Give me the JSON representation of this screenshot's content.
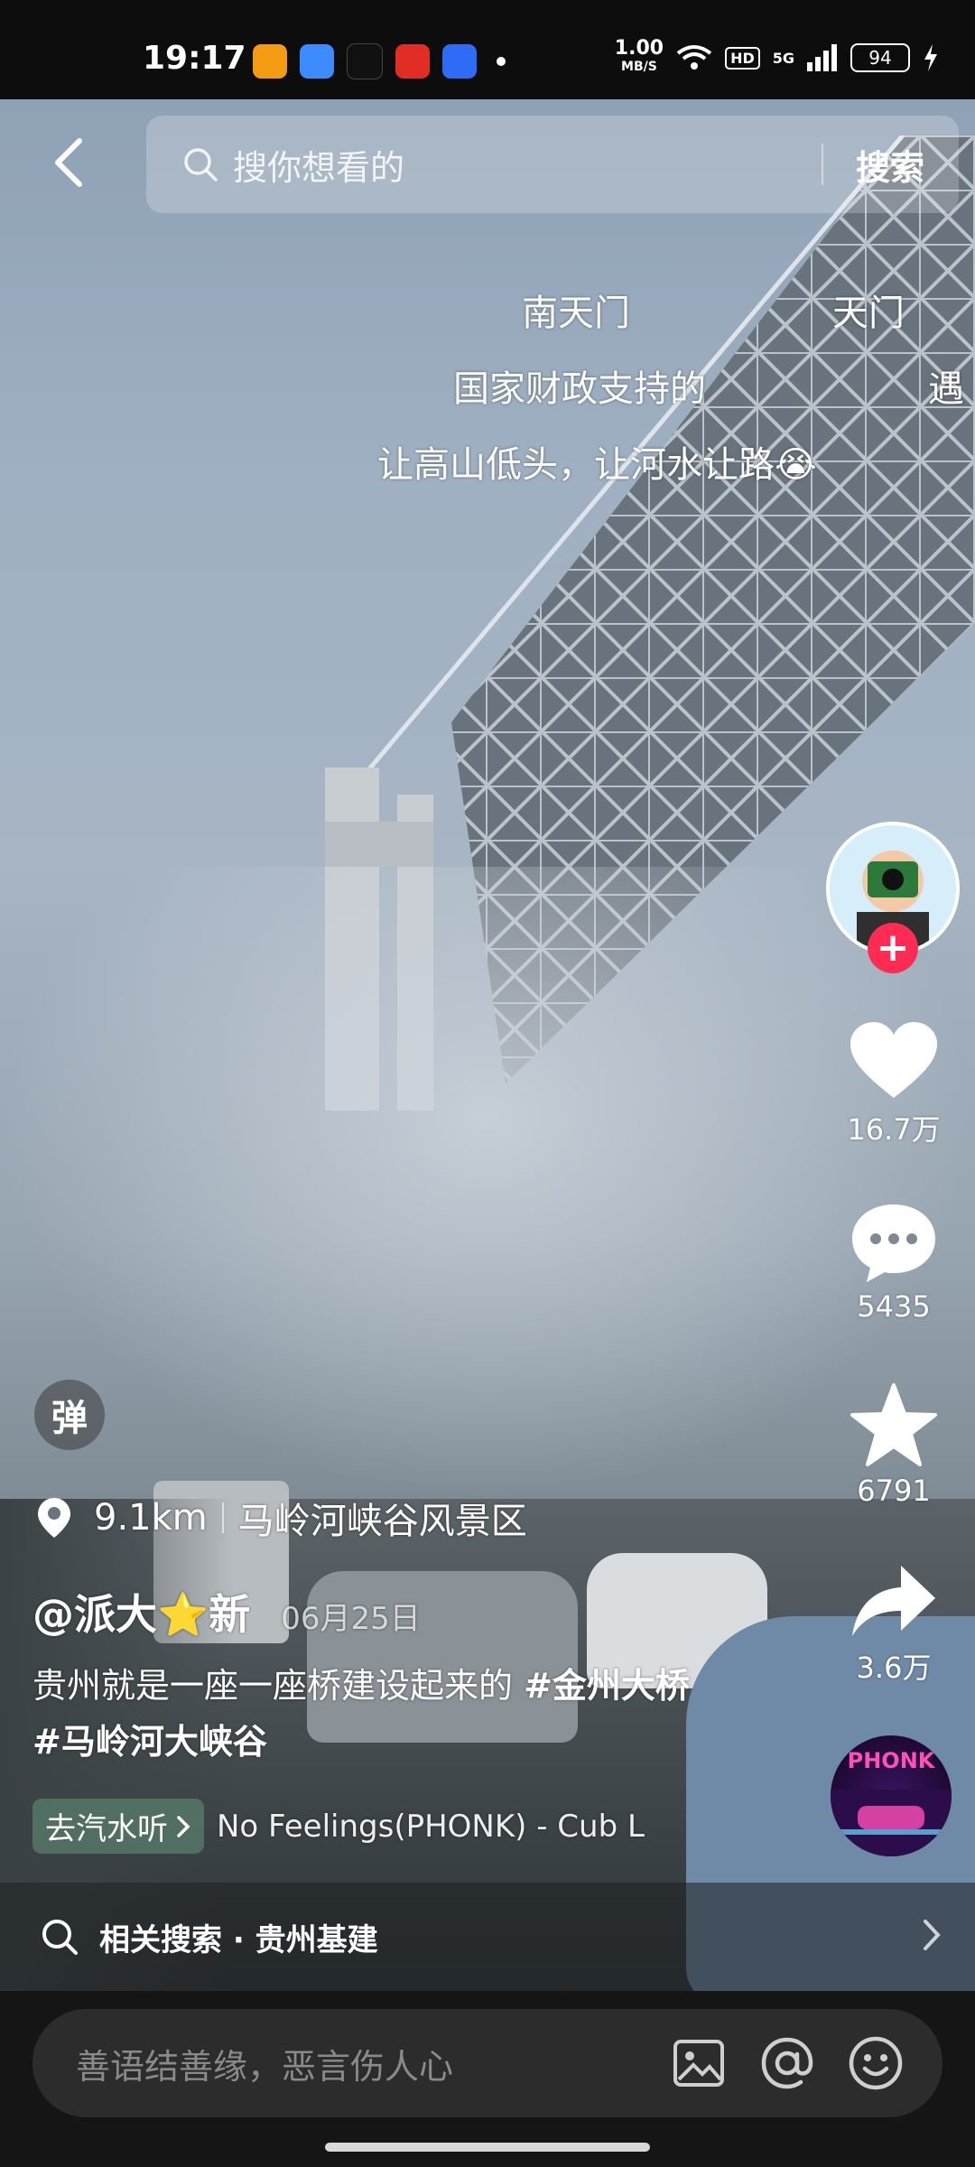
{
  "status_bar": {
    "time": "19:17",
    "app_icons": [
      {
        "name": "imou-app-icon",
        "color": "#f39c12"
      },
      {
        "name": "weather-app-icon",
        "color": "#3d8bfd"
      },
      {
        "name": "tiktok-app-icon",
        "color": "#111111"
      },
      {
        "name": "pdd-app-icon",
        "color": "#e02e24"
      },
      {
        "name": "baidu-app-icon",
        "color": "#2f6cf6"
      }
    ],
    "net_speed_value": "1.00",
    "net_speed_unit": "MB/S",
    "hd_label": "HD",
    "network_label": "5G",
    "battery_level": "94"
  },
  "search": {
    "placeholder": "搜你想看的",
    "button_label": "搜索"
  },
  "danmaku": [
    {
      "text": "南天门"
    },
    {
      "text": "天门"
    },
    {
      "text": "国家财政支持的"
    },
    {
      "text": "遇"
    },
    {
      "text": "让高山低头，让河水让路😭"
    }
  ],
  "actions": {
    "likes": "16.7万",
    "comments": "5435",
    "favorites": "6791",
    "shares": "3.6万"
  },
  "danmu_toggle_label": "弹",
  "location": {
    "distance": "9.1km",
    "place": "马岭河峡谷风景区"
  },
  "post": {
    "author": "@派大⭐新",
    "date": "06月25日",
    "desc_text": "贵州就是一座一座桥建设起来的 ",
    "hashtag_1": "#金州大桥",
    "hashtag_2": "#马岭河大峡谷"
  },
  "music": {
    "chip_label": "去汽水听",
    "song": "No Feelings(PHONK) - Cub L",
    "disc_label": "PHONK"
  },
  "related_search": {
    "label": "相关搜索 · 贵州基建"
  },
  "comment_input": {
    "placeholder": "善语结善缘，恶言伤人心"
  },
  "colors": {
    "accent_red": "#fe2c55",
    "music_chip": "#5a826e"
  }
}
